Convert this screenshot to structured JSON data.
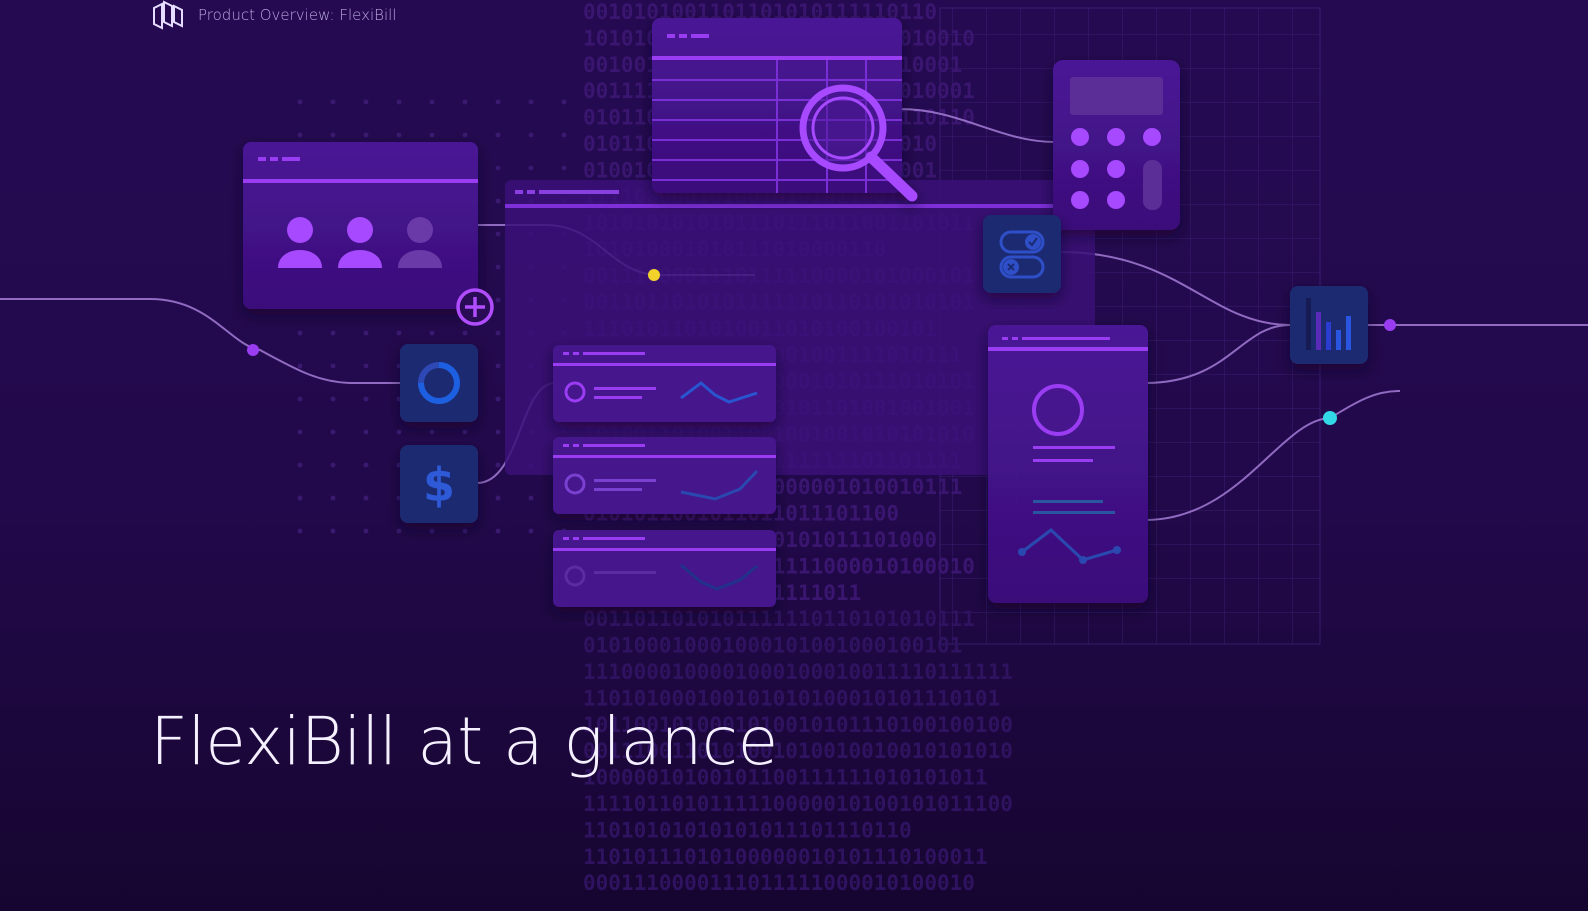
{
  "header": {
    "logo_icon": "brand-logo-icon",
    "breadcrumb": "Product Overview: FlexiBill"
  },
  "hero": {
    "title": "FlexiBill at a glance"
  },
  "illustration": {
    "binary_lines": [
      "0010101001101101010111110110",
      "1010101010111000101000001010010",
      "001001110010111010001101110001",
      "0011110101011011101001101010001",
      "0101101101001111001011010110110",
      "0101101010101001110001001010",
      "0100101001110100100100111001",
      "11110000010100101010110011",
      "1010101010101110111011001101011",
      "101010001010111010000110",
      "0011100001110111110000101000101",
      "0011011010101111110110101010101",
      "1110101101010011010100100101",
      "001010101001010001001111010111",
      "0110010110101010001010111010101",
      "0001010110110010101101001001001",
      "1010011010011001001001010101010",
      "110111100011000111111101101111",
      "101110111011110000001010010111",
      "0101011001011011011101100",
      "0001110010110000101011101000",
      "1011011001001011111000010100010",
      "0100110110101011111011",
      "0011011010101111110110101010111",
      "010100010001000101001000100101",
      "1110000100001000100010011110111111",
      "110101000100101010100010101110101",
      "1011001010001010010101110100100100",
      "0011100110101001010010010010101010",
      "10000010100101100111111010101011",
      "1111011010111110000010100101011100",
      "11010101010101011101110110",
      "11010111010100000010101110100011",
      "0001110000111011111000010100010"
    ],
    "icons": {
      "users": "users-icon",
      "add": "plus-circle-icon",
      "progress": "loading-ring-icon",
      "currency": "dollar-icon",
      "search": "magnifier-icon",
      "calculator": "calculator-icon",
      "toggles": "toggle-check-icon",
      "bar_chart": "bar-chart-icon",
      "profile": "profile-circle-icon"
    },
    "colors": {
      "accent": "#9a3df2",
      "yellow_node": "#f3d22b",
      "cyan_node": "#32d8e6",
      "blue_tile": "#1d2a72"
    }
  }
}
